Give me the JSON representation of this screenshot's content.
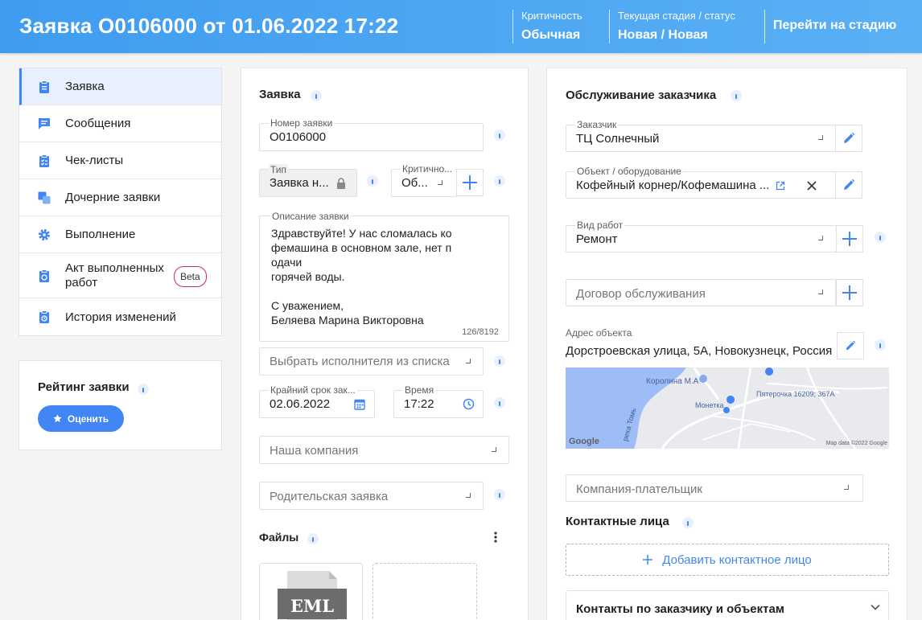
{
  "header": {
    "title": "Заявка O0106000 от 01.06.2022 17:22",
    "criticality_label": "Критичность",
    "criticality_value": "Обычная",
    "stage_label": "Текущая стадия / статус",
    "stage_value": "Новая / Новая",
    "goto_stage": "Перейти на стадию"
  },
  "nav": {
    "items": [
      {
        "label": "Заявка",
        "icon": "clipboard-icon",
        "active": true
      },
      {
        "label": "Сообщения",
        "icon": "chat-icon"
      },
      {
        "label": "Чек-листы",
        "icon": "checklist-icon"
      },
      {
        "label": "Дочерние заявки",
        "icon": "child-requests-icon"
      },
      {
        "label": "Выполнение",
        "icon": "gear-icon"
      },
      {
        "label": "Акт выполненных работ",
        "line1": "Акт выполненных",
        "line2": "работ",
        "badge": "Beta",
        "icon": "act-icon"
      },
      {
        "label": "История изменений",
        "icon": "history-icon"
      }
    ]
  },
  "rating": {
    "title": "Рейтинг заявки",
    "button": "Оценить"
  },
  "request": {
    "title": "Заявка",
    "number_label": "Номер заявки",
    "number_value": "O0106000",
    "type_label": "Тип",
    "type_value": "Заявка н...",
    "criticality_label": "Критично...",
    "criticality_value": "Об...",
    "description_label": "Описание заявки",
    "description": "Здравствуйте! У нас сломалась ко\nфемашина в основном зале, нет п\nодачи\nгорячей воды.\n\nС уважением,\nБеляева Марина Викторовна",
    "description_counter": "126/8192",
    "executor_placeholder": "Выбрать исполнителя из списка",
    "deadline_label": "Крайний срок зак...",
    "deadline_value": "02.06.2022",
    "time_label": "Время",
    "time_value": "17:22",
    "company_placeholder": "Наша компания",
    "parent_placeholder": "Родительская заявка",
    "files_title": "Файлы",
    "file_type": "EML"
  },
  "customer": {
    "title": "Обслуживание заказчика",
    "customer_label": "Заказчик",
    "customer_value": "ТЦ Солнечный",
    "object_label": "Объект / оборудование",
    "object_value": "Кофейный корнер/Кофемашина ...",
    "worktype_label": "Вид работ",
    "worktype_value": "Ремонт",
    "contract_placeholder": "Договор обслуживания",
    "address_label": "Адрес объекта",
    "address_value": "Дорстроевская улица, 5А, Новокузнецк, Россия",
    "map_labels": {
      "place1": "Королина М.А",
      "place2": "Монетка",
      "place3": "Пятерочка 16209; 367А",
      "river": "река Томь",
      "google": "Google",
      "mapdata": "Map data ©2022 Google"
    },
    "payer_placeholder": "Компания-плательщик",
    "contacts_title": "Контактные лица",
    "add_contact": "Добавить контактное лицо",
    "contacts_accordion": "Контакты по заказчику и объектам"
  },
  "colors": {
    "accent": "#4285f4",
    "header_from": "#3f9cf0",
    "header_to": "#5ab0f4",
    "beta_border": "#d32f4e"
  }
}
